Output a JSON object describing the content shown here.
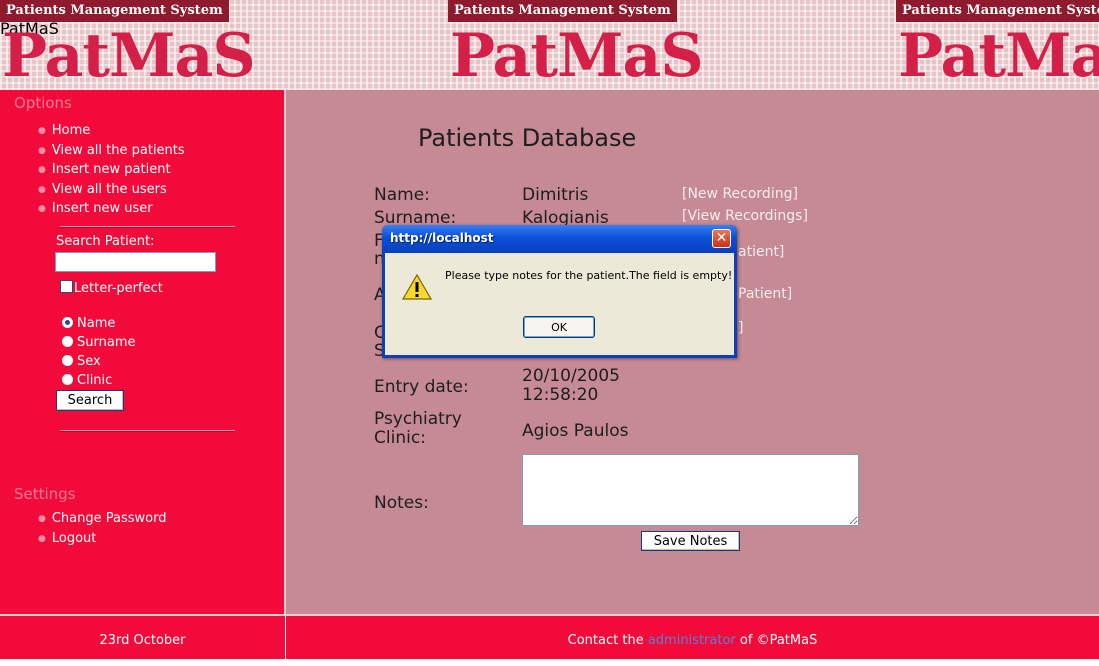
{
  "banner": {
    "system_title": "Patients Management System",
    "logo": "PatMaS",
    "mirrored_logo": "PatMaS"
  },
  "sidebar": {
    "options_title": "Options",
    "options": [
      {
        "label": "Home"
      },
      {
        "label": "View all the patients"
      },
      {
        "label": "Insert new patient"
      },
      {
        "label": "View all the users"
      },
      {
        "label": "Insert new user"
      }
    ],
    "search_label": "Search Patient:",
    "search_value": "",
    "letter_perfect_label": "Letter-perfect",
    "letter_perfect_checked": false,
    "radios": [
      {
        "label": "Name",
        "selected": true
      },
      {
        "label": "Surname",
        "selected": false
      },
      {
        "label": "Sex",
        "selected": false
      },
      {
        "label": "Clinic",
        "selected": false
      }
    ],
    "search_button": "Search",
    "settings_title": "Settings",
    "settings": [
      {
        "label": "Change Password"
      },
      {
        "label": "Logout"
      }
    ]
  },
  "main": {
    "title": "Patients Database",
    "name_label": "Name:",
    "name_value": "Dimitris",
    "surname_label": "Surname:",
    "surname_value": "Kalogianis",
    "entry_label": "Entry date:",
    "entry_date": "20/10/2005",
    "entry_time": "12:58:20",
    "clinic_label_1": "Psychiatry",
    "clinic_label_2": "Clinic:",
    "clinic_value": "Agios Paulos",
    "notes_label": "Notes:",
    "save_button": "Save Notes",
    "links": {
      "new_recording": "[New Recording]",
      "view_recordings": "[View Recordings]",
      "partial_1": "atient]",
      "partial_2": "Patient]",
      "partial_3": "]"
    },
    "partial_labels": {
      "f": "F",
      "n": "n",
      "a": "A",
      "c": "C",
      "s": "S"
    }
  },
  "footer": {
    "date": "23rd October",
    "contact_prefix": "Contact the",
    "admin_link": "administrator",
    "contact_suffix": "of ©PatMaS"
  },
  "dialog": {
    "title": "http://localhost",
    "message": "Please type notes for the patient.The field is empty!",
    "ok": "OK",
    "close": "✕"
  },
  "colors": {
    "sidebar": "#f20a3a",
    "main": "#c58a94",
    "banner_red": "#d42048",
    "link": "#5e7ed4"
  }
}
